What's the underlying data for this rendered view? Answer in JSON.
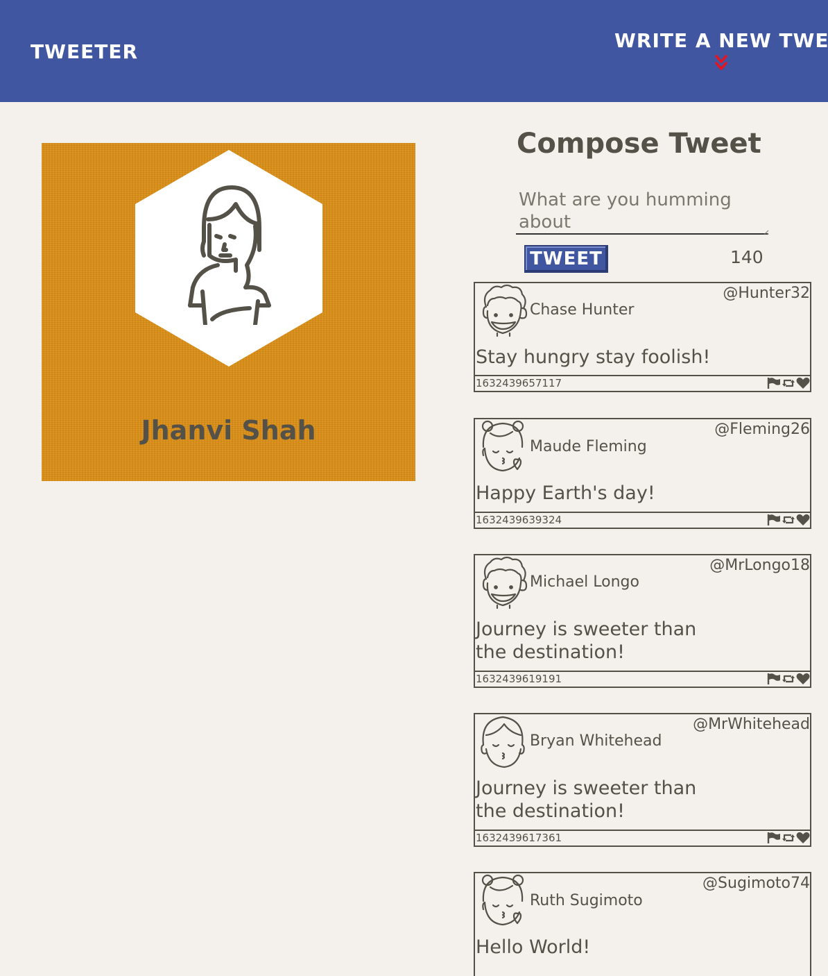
{
  "nav": {
    "brand": "TWEETER",
    "compose_link": "WRITE A NEW TWEET",
    "compose_icon": "double-chevron-down-icon",
    "accent": "#4056a1",
    "chevron_color": "#e8131f"
  },
  "profile": {
    "name": "Jhanvi Shah",
    "background": "#da8d14"
  },
  "compose": {
    "title": "Compose Tweet",
    "placeholder": "What are you humming about",
    "button_label": "TWEET",
    "counter": "140"
  },
  "tweets": [
    {
      "name": "Chase Hunter",
      "handle": "@Hunter32",
      "text": "Stay hungry stay foolish!",
      "timestamp": "1632439657117",
      "avatar": "curly-hair-boy-avatar"
    },
    {
      "name": "Maude Fleming",
      "handle": "@Fleming26",
      "text": "Happy Earth's day!",
      "timestamp": "1632439639324",
      "avatar": "girl-kiss-avatar"
    },
    {
      "name": "Michael Longo",
      "handle": "@MrLongo18",
      "text": "Journey is sweeter than the destination!",
      "timestamp": "1632439619191",
      "avatar": "curly-hair-boy-avatar"
    },
    {
      "name": "Bryan Whitehead",
      "handle": "@MrWhitehead",
      "text": "Journey is sweeter than the destination!",
      "timestamp": "1632439617361",
      "avatar": "boy-kiss-avatar"
    },
    {
      "name": "Ruth Sugimoto",
      "handle": "@Sugimoto74",
      "text": "Hello World!",
      "timestamp": "",
      "avatar": "girl-kiss-avatar"
    }
  ],
  "tweet_actions": [
    "flag-icon",
    "retweet-icon",
    "heart-icon"
  ]
}
